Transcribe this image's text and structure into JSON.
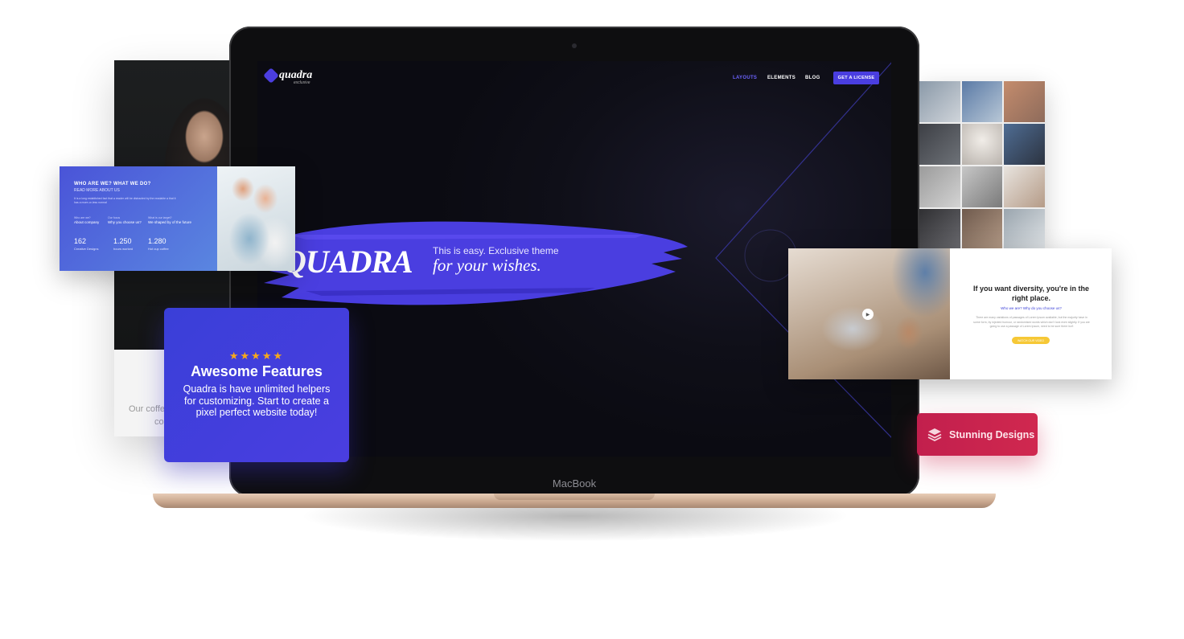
{
  "portrait_card": {
    "caption_line1": "Our coffe",
    "caption_line2": "co"
  },
  "laptop": {
    "brand": "MacBook"
  },
  "site": {
    "logo_text": "quadra",
    "logo_sub": "exclusive",
    "nav": [
      {
        "label": "LAYOUTS",
        "active": true
      },
      {
        "label": "ELEMENTS",
        "active": false
      },
      {
        "label": "BLOG",
        "active": false
      }
    ],
    "cta_label": "GET A LICENSE",
    "hero_title": "QUADRA",
    "hero_sub1": "This is easy. Exclusive theme",
    "hero_sub2": "for your wishes.",
    "accent": "#4a3ee0"
  },
  "who_card": {
    "title": "WHO ARE WE? WHAT WE DO?",
    "subtitle": "READ MORE ABOUT US",
    "text": "It is a long established fact that a reader will be distracted by the readable a that it has a more-or-less normal",
    "columns": [
      {
        "head": "Who are we?",
        "title": "About company"
      },
      {
        "head": "Our focus",
        "title": "Why you choose us?"
      },
      {
        "head": "What is our target?",
        "title": "We shaped by of the future"
      }
    ],
    "stats": [
      {
        "num": "162",
        "label": "Creative Designs"
      },
      {
        "num": "1.250",
        "label": "hours worked"
      },
      {
        "num": "1.280",
        "label": "Hot cup coffee"
      }
    ]
  },
  "features_card": {
    "stars": "★★★★★",
    "title": "Awesome Features",
    "text": "Quadra is have unlimited helpers for customizing. Start to create a pixel perfect website today!",
    "star_color": "#f7a81b"
  },
  "diversity_card": {
    "title": "If you want diversity, you're in the right place.",
    "subtitle": "Who we are? Why do you choose us?",
    "text": "There are many variations of passages of Lorem Ipsum available, but the majority have in some form, by injected humour, or randomised words which don't look even slightly. If you are going to use a passage of Lorem Ipsum, need to be sure there isn't",
    "button": "WATCH OUR VIDEO",
    "play_icon": "play-icon"
  },
  "stunning": {
    "label": "Stunning Designs",
    "icon": "layers-icon",
    "color": "#c21f4d"
  },
  "photo_grid": {
    "tiles": 12
  }
}
